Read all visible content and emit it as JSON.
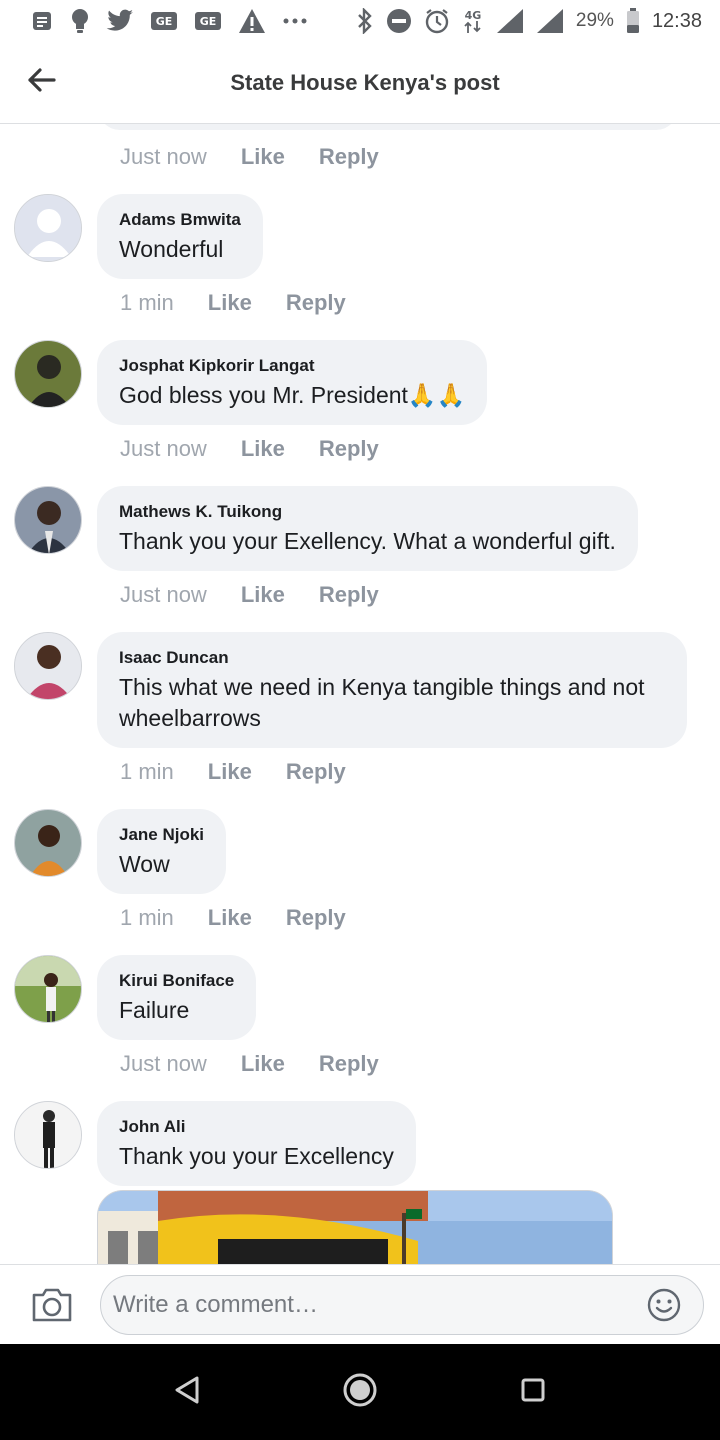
{
  "status_bar": {
    "battery_percent": "29%",
    "time": "12:38",
    "network": "4G",
    "icons": [
      "notes-icon",
      "bulb-icon",
      "twitter-icon",
      "ge-icon",
      "ge-icon",
      "warning-icon",
      "more-icon",
      "bluetooth-icon",
      "dnd-icon",
      "alarm-icon",
      "signal-icon",
      "signal-icon",
      "battery-icon"
    ]
  },
  "header": {
    "title": "State House Kenya's post",
    "back_icon": "back-arrow-icon"
  },
  "previous_comment_actions": {
    "time": "Just now",
    "like": "Like",
    "reply": "Reply"
  },
  "comments": [
    {
      "author": "Adams Bmwita",
      "text": "Wonderful",
      "time": "1 min",
      "like": "Like",
      "reply": "Reply"
    },
    {
      "author": "Josphat Kipkorir Langat",
      "text": "God bless you Mr. President🙏🙏",
      "time": "Just now",
      "like": "Like",
      "reply": "Reply"
    },
    {
      "author": "Mathews K. Tuikong",
      "text": "Thank you your Exellency. What a wonderful gift.",
      "time": "Just now",
      "like": "Like",
      "reply": "Reply"
    },
    {
      "author": "Isaac Duncan",
      "text": "This what we need in Kenya tangible things and not wheelbarrows",
      "time": "1 min",
      "like": "Like",
      "reply": "Reply"
    },
    {
      "author": "Jane Njoki",
      "text": "Wow",
      "time": "1 min",
      "like": "Like",
      "reply": "Reply"
    },
    {
      "author": "Kirui Boniface",
      "text": "Failure",
      "time": "Just now",
      "like": "Like",
      "reply": "Reply"
    },
    {
      "author": "John Ali",
      "text": "Thank you your Excellency"
    }
  ],
  "composer": {
    "placeholder": "Write a comment…",
    "camera_icon": "camera-icon",
    "emoji_icon": "emoji-icon"
  },
  "nav": {
    "back_icon": "nav-back-icon",
    "home_icon": "nav-home-icon",
    "recents_icon": "nav-recents-icon"
  },
  "colors": {
    "bubble": "#f0f2f5",
    "action_text": "#8d949e",
    "header_title": "#3a3b3c"
  }
}
